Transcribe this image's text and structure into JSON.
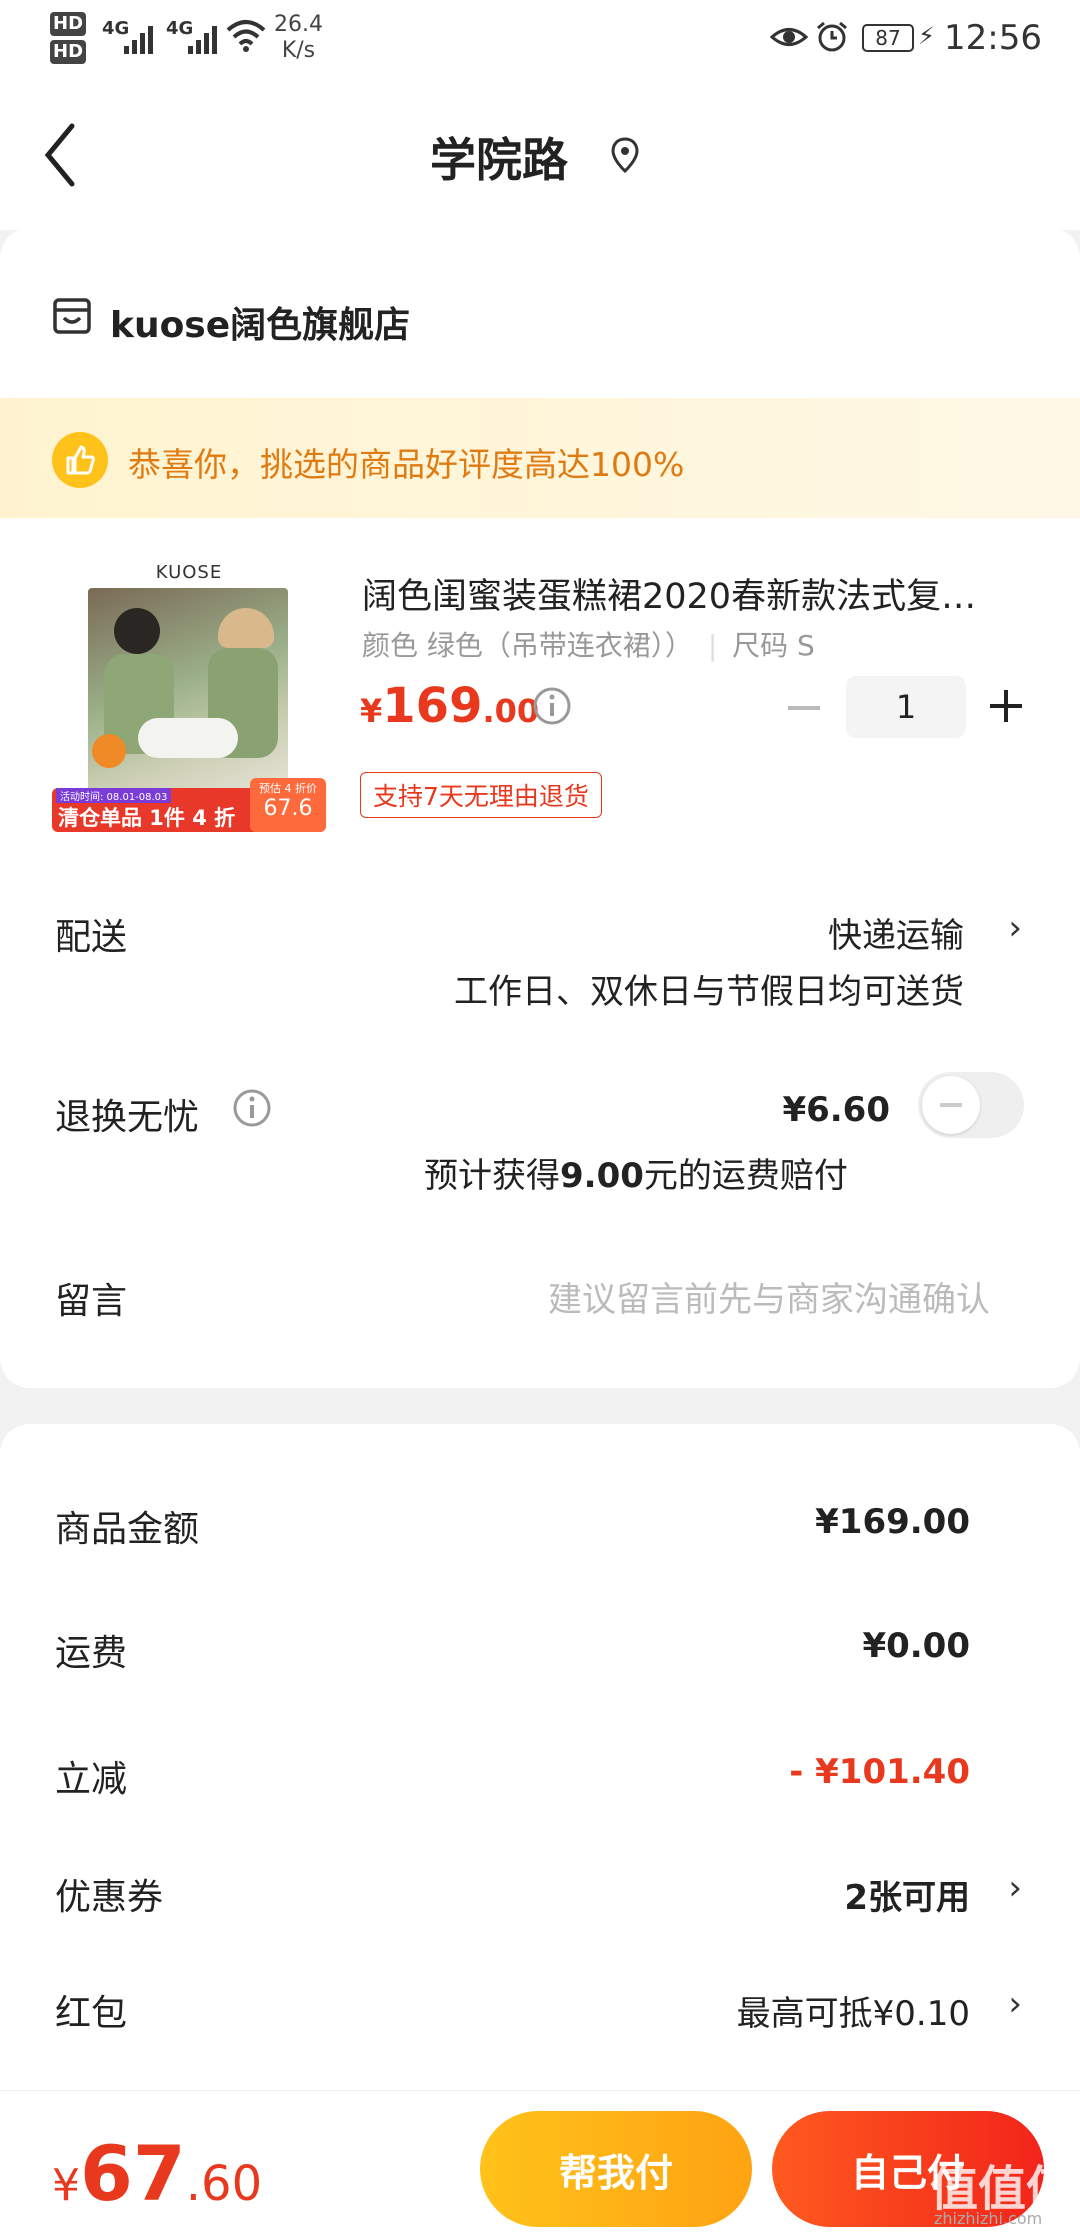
{
  "status": {
    "hd1": "HD",
    "hd2": "HD",
    "sim1": "4G",
    "sim2": "4G",
    "speed_value": "26.4",
    "speed_unit": "K/s",
    "battery": "87",
    "time": "12:56"
  },
  "nav": {
    "title": "学院路"
  },
  "shop": {
    "name": "kuose阔色旗舰店"
  },
  "banner": {
    "text": "恭喜你，挑选的商品好评度高达100%"
  },
  "product": {
    "image_brand": "KUOSE",
    "image_ribbon_small": "活动时间: 08.01-08.03",
    "image_ribbon": "清仓单品 1件 4 折",
    "image_badge_top": "预估 4 折价",
    "image_badge_price": "67.6",
    "title": "阔色闺蜜装蛋糕裙2020春新款法式复…",
    "spec_color": "颜色 绿色（吊带连衣裙））",
    "spec_size": "尺码 S",
    "price_symbol": "¥",
    "price_int": "169",
    "price_dec": ".00",
    "quantity": "1",
    "tag": "支持7天无理由退货"
  },
  "delivery": {
    "label": "配送",
    "method": "快递运输",
    "note": "工作日、双休日与节假日均可送货"
  },
  "insurance": {
    "label": "退换无忧",
    "price": "¥6.60",
    "note_prefix": "预计获得",
    "note_amount": "9.00",
    "note_suffix": "元的运费赔付"
  },
  "message": {
    "label": "留言",
    "placeholder": "建议留言前先与商家沟通确认"
  },
  "summary": {
    "goods_label": "商品金额",
    "goods_value": "¥169.00",
    "shipping_label": "运费",
    "shipping_value": "¥0.00",
    "discount_label": "立减",
    "discount_value": "- ¥101.40",
    "coupon_label": "优惠券",
    "coupon_value": "2张可用",
    "redpacket_label": "红包",
    "redpacket_value": "最高可抵¥0.10"
  },
  "footer": {
    "total_symbol": "¥",
    "total_int": "67",
    "total_dec": ".60",
    "help_pay": "帮我付",
    "self_pay": "自己付",
    "watermark": "值值值",
    "watermark_sub": "zhizhizhi.com"
  },
  "colors": {
    "accent_red": "#e8381d",
    "orange_gradient_start": "#ffbe0f",
    "red_gradient_start": "#ff5a1f"
  }
}
